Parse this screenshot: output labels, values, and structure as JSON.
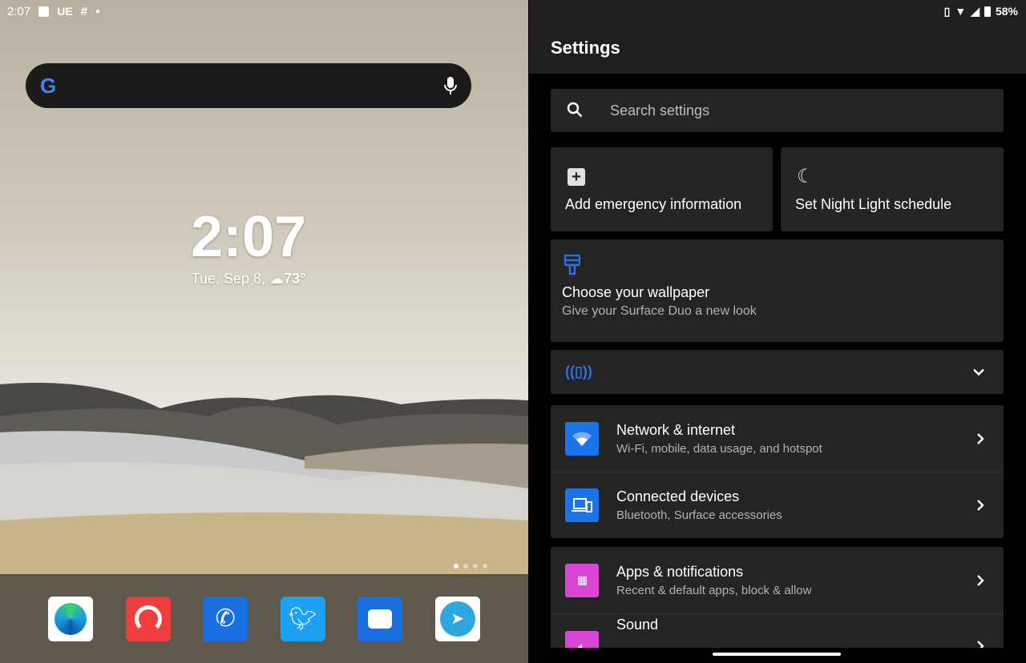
{
  "status_left": {
    "time": "2:07",
    "notif_text": "UE",
    "icons": [
      "image-icon",
      "slack-icon",
      "dot-icon"
    ]
  },
  "status_right": {
    "battery": "58%",
    "icons": [
      "vibrate-icon",
      "wifi-icon",
      "signal-icon",
      "battery-icon"
    ]
  },
  "home": {
    "search_icons": [
      "google-logo",
      "mic-icon"
    ],
    "clock": "2:07",
    "date": "Tue, Sep 8,",
    "weather": "73°",
    "page_count": 4,
    "current_page": 1,
    "dock": [
      "Microsoft Edge",
      "Pocket Casts",
      "Phone",
      "Twitter",
      "Messages",
      "Telegram"
    ]
  },
  "settings": {
    "title": "Settings",
    "search_placeholder": "Search settings",
    "suggestions": [
      {
        "label": "Add emergency information"
      },
      {
        "label": "Set Night Light schedule"
      }
    ],
    "wallpaper": {
      "title": "Choose your wallpaper",
      "subtitle": "Give your Surface Duo a new look"
    },
    "items": [
      {
        "title": "Network & internet",
        "subtitle": "Wi-Fi, mobile, data usage, and hotspot",
        "color": "#1a73e8"
      },
      {
        "title": "Connected devices",
        "subtitle": "Bluetooth, Surface accessories",
        "color": "#1a73e8"
      },
      {
        "title": "Apps & notifications",
        "subtitle": "Recent & default apps, block & allow",
        "color": "#d946d6"
      },
      {
        "title": "Sound",
        "subtitle": "",
        "color": "#d946d6"
      }
    ],
    "accent": "#2f6fe0"
  }
}
